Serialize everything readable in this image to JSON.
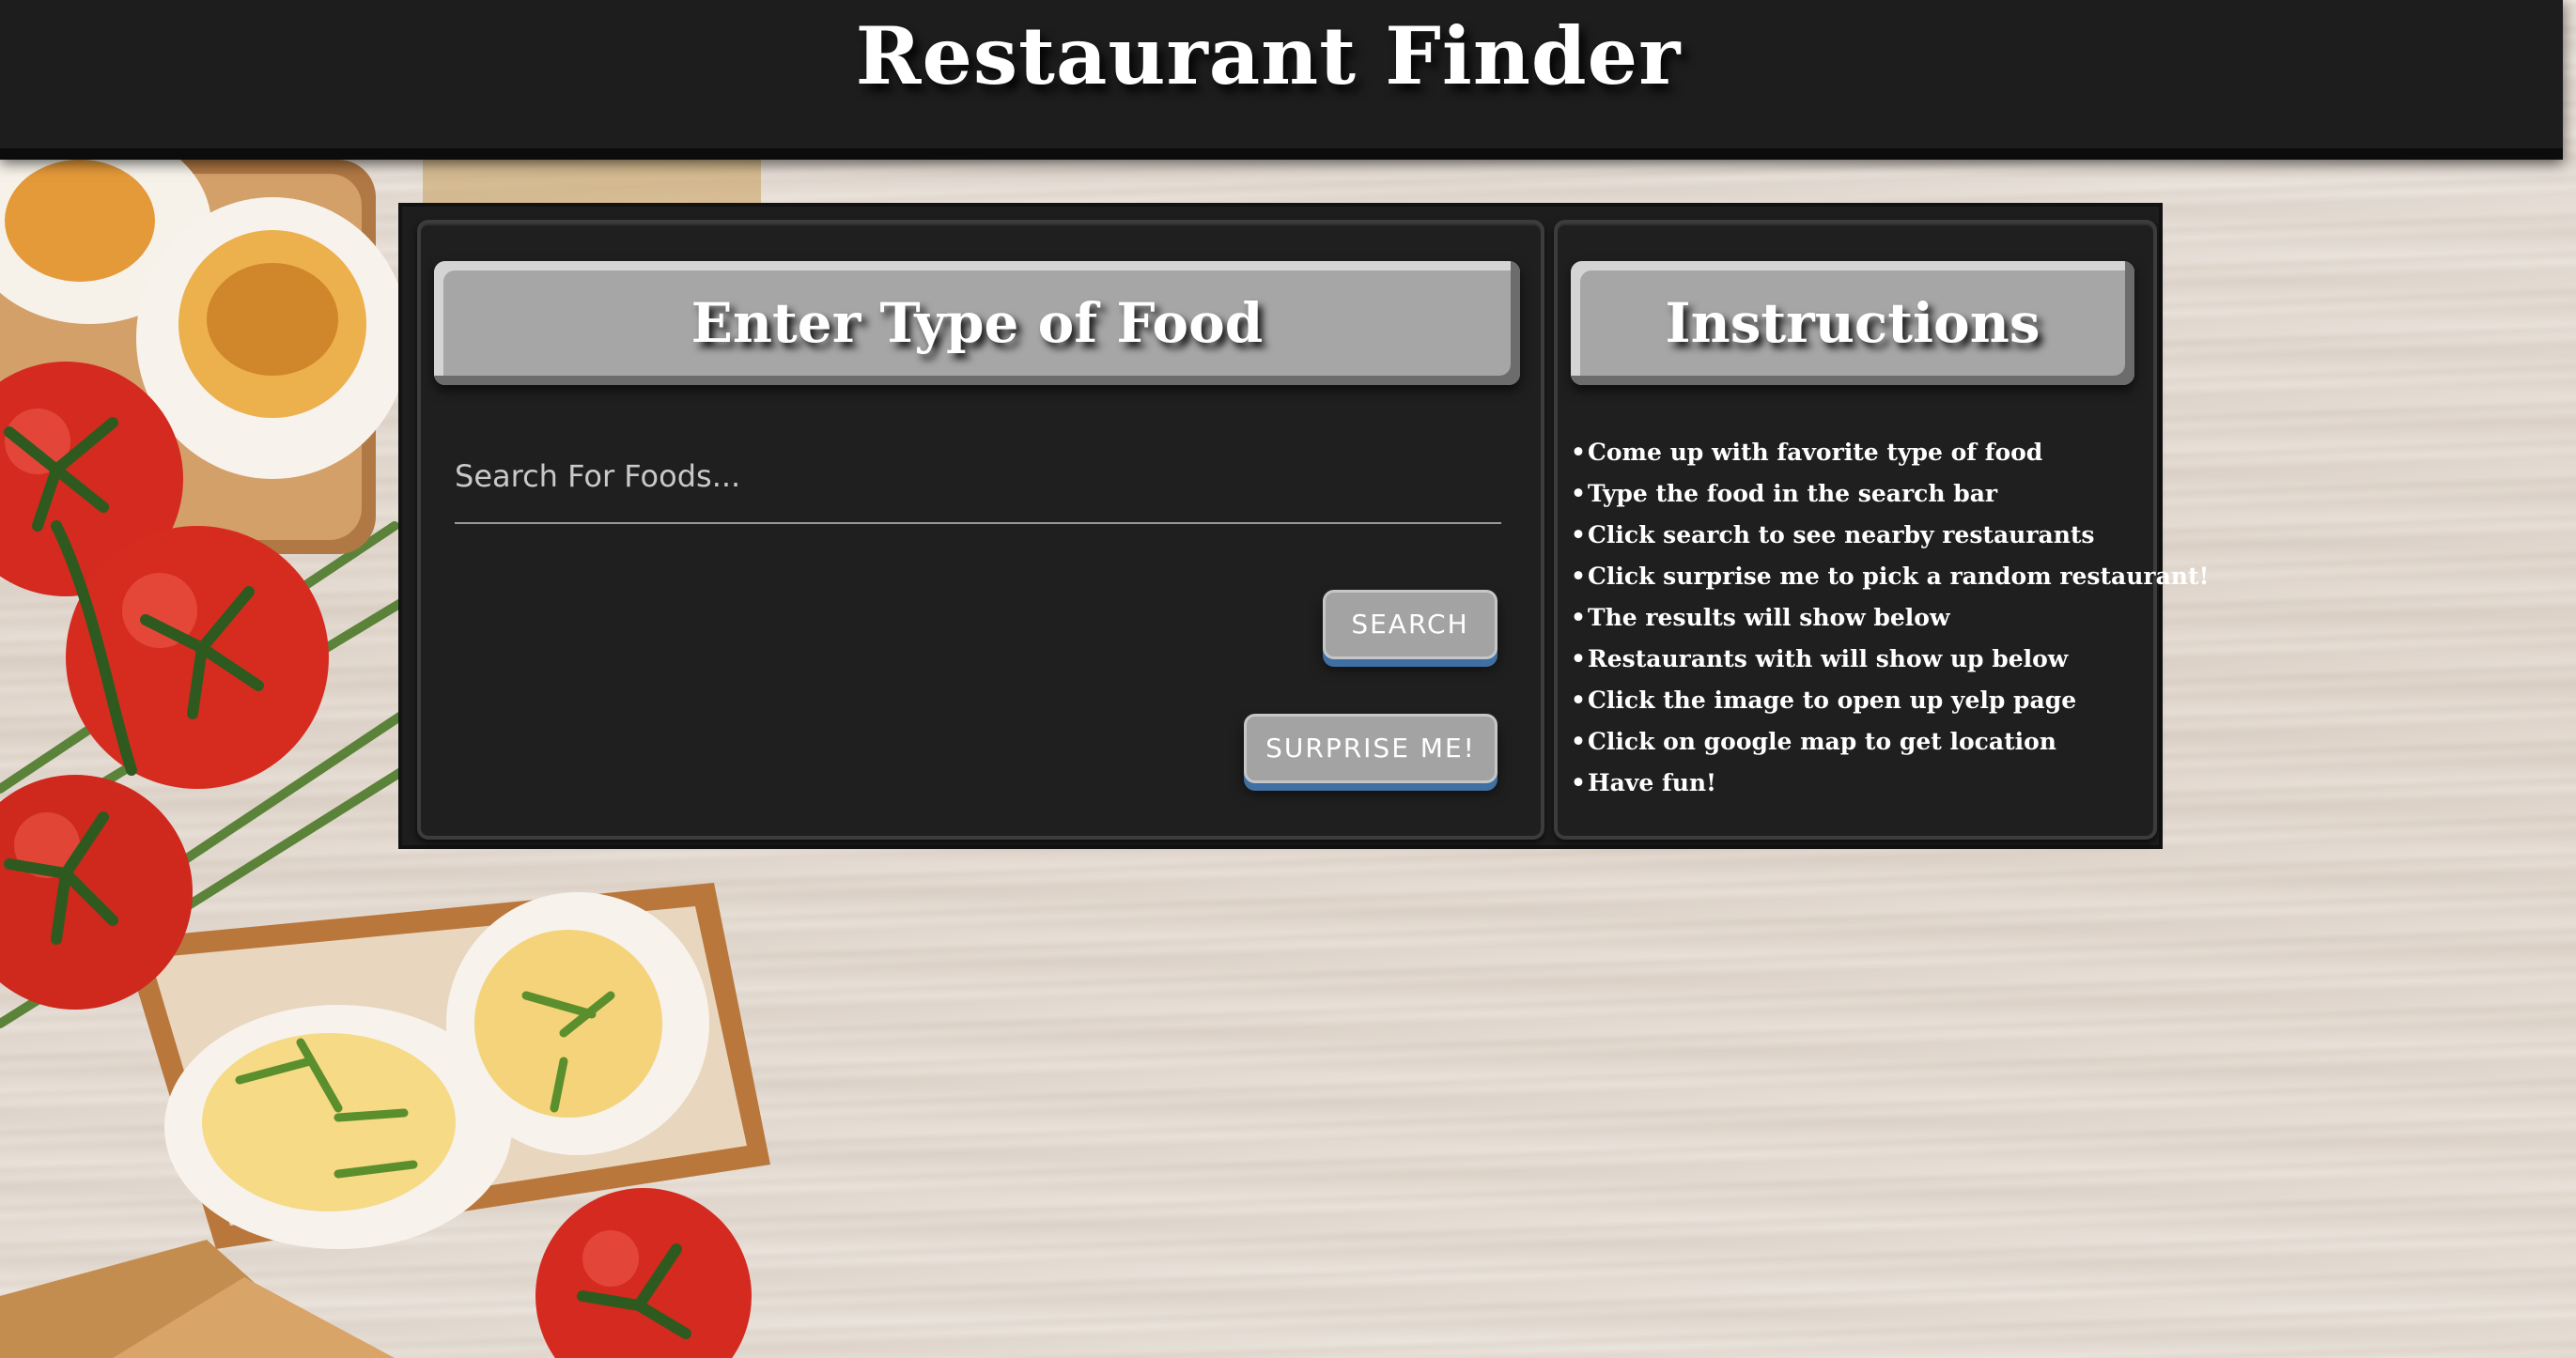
{
  "header": {
    "title": "Restaurant Finder"
  },
  "search_card": {
    "heading": "Enter Type of Food",
    "search_placeholder": "Search For Foods...",
    "search_value": "",
    "search_button": "SEARCH",
    "surprise_button": "SURPRISE ME!"
  },
  "instructions_card": {
    "heading": "Instructions",
    "bullet": "•",
    "items": [
      "Come up with favorite type of food",
      "Type the food in the search bar",
      "Click search to see nearby restaurants",
      "Click surprise me to pick a random restaurant!",
      "The results will show below",
      "Restaurants with will show up below",
      "Click the image to open up yelp page",
      "Click on google map to get location",
      "Have fun!"
    ]
  },
  "colors": {
    "header_bg": "#1e1d1d",
    "panel_bg": "#1e1d1d",
    "card_heading_bg": "#a6a6a6",
    "button_bg": "#a3a3a3",
    "button_accent": "#3f6fa3",
    "text": "#ffffff"
  }
}
